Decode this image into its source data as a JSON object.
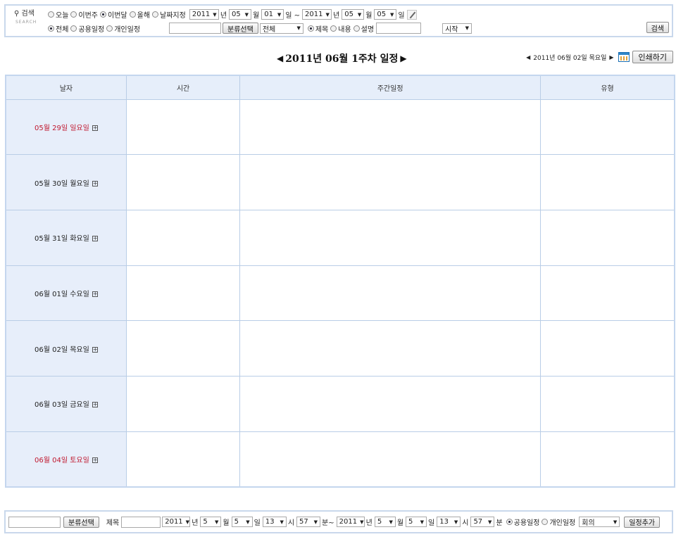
{
  "search": {
    "label": "검색",
    "label_sub": "SEARCH",
    "period_options": [
      {
        "label": "오늘",
        "checked": false
      },
      {
        "label": "이번주",
        "checked": false
      },
      {
        "label": "이번달",
        "checked": true
      },
      {
        "label": "올해",
        "checked": false
      },
      {
        "label": "날짜지정",
        "checked": false
      }
    ],
    "from": {
      "year": "2011",
      "month": "05",
      "day": "01"
    },
    "to": {
      "year": "2011",
      "month": "05",
      "day": "05"
    },
    "units": {
      "year": "년",
      "month": "월",
      "day": "일",
      "range_sep": "일 ~"
    },
    "type_options": [
      {
        "label": "전체",
        "checked": true
      },
      {
        "label": "공용일정",
        "checked": false
      },
      {
        "label": "개인일정",
        "checked": false
      }
    ],
    "category_button": "분류선택",
    "category_select": "전체",
    "field_options": [
      {
        "label": "제목",
        "checked": true
      },
      {
        "label": "내용",
        "checked": false
      },
      {
        "label": "설명",
        "checked": false
      }
    ],
    "match_select": "시작",
    "search_button": "검색"
  },
  "header": {
    "title": "2011년 06월 1주차 일정",
    "current_date": "2011년 06월 02일 목요일",
    "print_button": "인쇄하기"
  },
  "table": {
    "columns": [
      "날자",
      "시간",
      "주간일정",
      "유형"
    ],
    "rows": [
      {
        "date": "05월 29일 일요일",
        "holiday": true
      },
      {
        "date": "05월 30일 월요일",
        "holiday": false
      },
      {
        "date": "05월 31일 화요일",
        "holiday": false
      },
      {
        "date": "06월 01일 수요일",
        "holiday": false
      },
      {
        "date": "06월 02일 목요일",
        "holiday": false
      },
      {
        "date": "06월 03일 금요일",
        "holiday": false
      },
      {
        "date": "06월 04일 토요일",
        "holiday": true
      }
    ]
  },
  "add": {
    "category_button": "분류선택",
    "title_label": "제목",
    "start": {
      "year": "2011",
      "month": "5",
      "day": "5",
      "hour": "13",
      "minute": "57"
    },
    "end": {
      "year": "2011",
      "month": "5",
      "day": "5",
      "hour": "13",
      "minute": "57"
    },
    "units": {
      "year": "년",
      "month": "월",
      "day": "일",
      "hour": "시",
      "minute_start": "분~",
      "minute_end": "분"
    },
    "type_options": [
      {
        "label": "공용일정",
        "checked": true
      },
      {
        "label": "개인일정",
        "checked": false
      }
    ],
    "kind_select": "회의",
    "add_button": "일정추가"
  },
  "colors": {
    "accent": "#c4d6ee",
    "header_bg": "#e6eefa",
    "holiday": "#c0182f"
  }
}
